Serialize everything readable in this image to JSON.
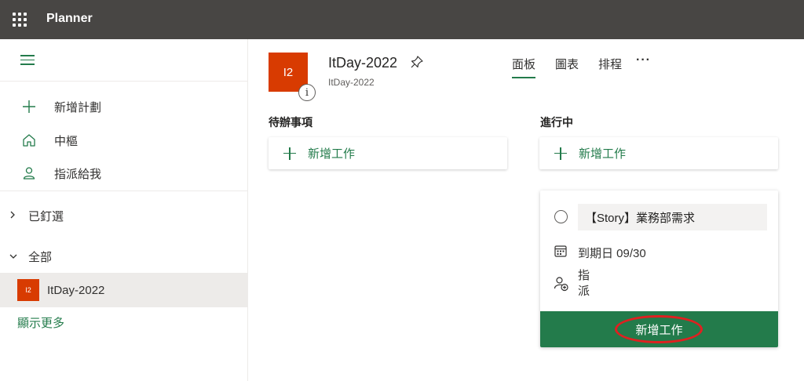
{
  "app": {
    "title": "Planner"
  },
  "sidebar": {
    "items": [
      {
        "label": "新增計劃",
        "icon": "plus-icon"
      },
      {
        "label": "中樞",
        "icon": "home-icon"
      },
      {
        "label": "指派給我",
        "icon": "person-icon"
      }
    ],
    "pinned_label": "已釘選",
    "all_label": "全部",
    "plan": {
      "tile": "I2",
      "name": "ItDay-2022"
    },
    "show_more": "顯示更多"
  },
  "plan": {
    "tile": "I2",
    "info": "i",
    "name": "ItDay-2022",
    "subtitle": "ItDay-2022"
  },
  "tabs": [
    {
      "label": "面板",
      "active": true
    },
    {
      "label": "圖表",
      "active": false
    },
    {
      "label": "排程",
      "active": false
    }
  ],
  "more_label": "···",
  "buckets": [
    {
      "title": "待辦事項",
      "add_task": "新增工作"
    },
    {
      "title": "進行中",
      "add_task": "新增工作"
    }
  ],
  "task_form": {
    "title_value": "【Story】業務部需求",
    "due_date": "到期日 09/30",
    "assign": "指派",
    "submit": "新增工作"
  },
  "colors": {
    "topbar": "#484644",
    "accent": "#237b4b",
    "plan_tile": "#d83b01",
    "highlight": "#e02020"
  }
}
